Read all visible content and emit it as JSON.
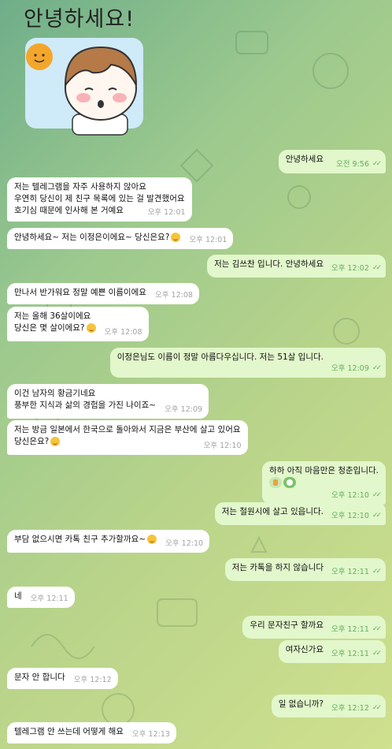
{
  "sticker": {
    "title": "안녕하세요!"
  },
  "messages": [
    {
      "dir": "out",
      "text": "안녕하세요",
      "time": "오전 9:56",
      "read": true
    },
    {
      "dir": "in",
      "text": "저는 텔레그램을 자주 사용하지 않아요\n우연히 당신이 제 친구 목록에 있는 걸 발견했어요\n호기심 때문에 인사해 본 거예요",
      "time": "오후 12:01"
    },
    {
      "dir": "in",
      "text": "안녕하세요~ 저는 이정은이에요~ 당신은요?",
      "emoji": true,
      "time": "오후 12:01"
    },
    {
      "dir": "out",
      "text": "저는 김쓰찬 입니다. 안녕하세요",
      "time": "오후 12:02",
      "read": true
    },
    {
      "dir": "in",
      "text": "만나서 반가워요 정말 예쁜 이름이에요",
      "time": "오후 12:08"
    },
    {
      "dir": "in",
      "text": "저는 올해 36살이에요\n당신은 몇 살이에요?",
      "emoji": true,
      "time": "오후 12:08"
    },
    {
      "dir": "out",
      "text": "이정은님도 이름이 정말 아름다우십니다. 저는 51살 입니다.",
      "time": "오후 12:09",
      "read": true
    },
    {
      "dir": "in",
      "text": "이건 남자의 황금기네요\n풍부한 지식과 삶의 경험을 가진 나이죠~",
      "time": "오후 12:09"
    },
    {
      "dir": "in",
      "text": "저는 방금 일본에서 한국으로 돌아와서 지금은 부산에 살고 있어요\n당신은요?",
      "emoji": true,
      "time": "오후 12:10"
    },
    {
      "dir": "out",
      "text": "하하 아직 마음만은 청춘입니다.",
      "reactions": true,
      "time": "오후 12:10",
      "read": true
    },
    {
      "dir": "out",
      "text": "저는 철원시에 살고 있읍니다.",
      "time": "오후 12:10",
      "read": true
    },
    {
      "dir": "in",
      "text": "부담 없으시면 카톡 친구 추가할까요~",
      "emoji": true,
      "time": "오후 12:10"
    },
    {
      "dir": "out",
      "text": "저는 카톡을 하지 않습니다",
      "time": "오후 12:11",
      "read": true
    },
    {
      "dir": "in",
      "text": "네",
      "time": "오후 12:11"
    },
    {
      "dir": "out",
      "text": "우리 문자친구 할까요",
      "time": "오후 12:11",
      "read": true
    },
    {
      "dir": "out",
      "text": "여자신가요",
      "time": "오후 12:11",
      "read": true
    },
    {
      "dir": "in",
      "text": "문자 안 합니다",
      "time": "오후 12:12"
    },
    {
      "dir": "out",
      "text": "일 없습니까?",
      "time": "오후 12:12",
      "read": true
    },
    {
      "dir": "in",
      "text": "텔레그램 안 쓰는데 어떻게 해요",
      "time": "오후 12:13"
    }
  ]
}
